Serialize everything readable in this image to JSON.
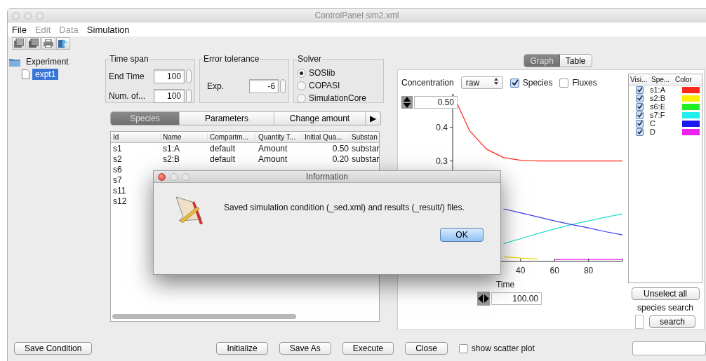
{
  "window": {
    "title": "ControlPanel sim2.xml"
  },
  "menu": [
    {
      "label": "File",
      "disabled": false
    },
    {
      "label": "Edit",
      "disabled": true
    },
    {
      "label": "Data",
      "disabled": true
    },
    {
      "label": "Simulation",
      "disabled": false
    }
  ],
  "tree": [
    {
      "label": "Experiment",
      "kind": "folder",
      "selected": false,
      "children": [
        {
          "label": "expt1",
          "kind": "file",
          "selected": true
        }
      ]
    }
  ],
  "time_span": {
    "title": "Time span",
    "fields": [
      {
        "label": "End Time",
        "value": "100"
      },
      {
        "label": "Num. of...",
        "value": "100"
      }
    ]
  },
  "error_tolerance": {
    "title": "Error tolerance",
    "label": "Exp.",
    "value": "-6"
  },
  "solver": {
    "title": "Solver",
    "options": [
      {
        "label": "SOSlib",
        "selected": true
      },
      {
        "label": "COPASI",
        "selected": false
      },
      {
        "label": "SimulationCore",
        "selected": false
      }
    ]
  },
  "species_tabs": [
    {
      "label": "Species",
      "selected": true
    },
    {
      "label": "Parameters",
      "selected": false
    },
    {
      "label": "Change amount",
      "selected": false
    }
  ],
  "species_tabs_more": "▶",
  "species_table": {
    "columns": [
      "Id",
      "Name",
      "Compartm...",
      "Quantity T...",
      "Initial Qua...",
      "Substan"
    ],
    "rows": [
      [
        "s1",
        "s1:A",
        "default",
        "Amount",
        "0.50",
        "substar"
      ],
      [
        "s2",
        "s2:B",
        "default",
        "Amount",
        "0.20",
        "substar"
      ],
      [
        "s6"
      ],
      [
        "s7"
      ],
      [
        "s11"
      ],
      [
        "s12"
      ]
    ]
  },
  "result_tabs": [
    {
      "label": "Graph",
      "selected": true
    },
    {
      "label": "Table",
      "selected": false
    }
  ],
  "graph": {
    "label": "Concentration",
    "mode": "raw",
    "options": [
      {
        "label": "Species",
        "checked": true
      },
      {
        "label": "Fluxes",
        "checked": false
      }
    ],
    "y_max": "0.50",
    "x_max": "100.00",
    "chart_data": {
      "type": "line",
      "xlabel": "Time",
      "x": [
        0,
        10,
        20,
        30,
        40,
        50,
        60,
        70,
        80,
        90,
        100
      ],
      "xlim": [
        0,
        100
      ],
      "ylim": [
        0,
        0.5
      ],
      "xticks": [
        40,
        60,
        80
      ],
      "yticks": [
        0.3,
        0.4
      ],
      "series": [
        {
          "color": "#ff2a1a",
          "values": [
            0.5,
            0.39,
            0.335,
            0.31,
            0.302,
            0.3,
            0.3,
            0.3,
            0.3,
            0.3,
            0.3
          ]
        },
        {
          "color": "#e8d800",
          "values": [
            null,
            null,
            null,
            0.014,
            0.01,
            0.007,
            null,
            null,
            null,
            null,
            null
          ]
        },
        {
          "color": "#22ddcc",
          "values": [
            null,
            null,
            null,
            0.053,
            0.068,
            0.083,
            0.097,
            0.11,
            0.121,
            0.132,
            0.142
          ]
        },
        {
          "color": "#3a3aee",
          "values": [
            null,
            null,
            null,
            0.157,
            0.145,
            0.133,
            0.121,
            0.11,
            0.1,
            0.089,
            0.079
          ]
        },
        {
          "color": "#ee22ee",
          "values": [
            null,
            null,
            null,
            null,
            null,
            null,
            0.006,
            0.006,
            0.006,
            0.006,
            0.006
          ]
        }
      ]
    }
  },
  "legend": {
    "columns": [
      "Visi...",
      "Spe...",
      "Color"
    ],
    "rows": [
      {
        "species": "s1:A",
        "visible": true,
        "color": "#ff2a1a"
      },
      {
        "species": "s2:B",
        "visible": true,
        "color": "#ffee00"
      },
      {
        "species": "s6:E",
        "visible": true,
        "color": "#22ee22"
      },
      {
        "species": "s7:F",
        "visible": true,
        "color": "#22eeee"
      },
      {
        "species": "C",
        "visible": true,
        "color": "#1a1aee"
      },
      {
        "species": "D",
        "visible": true,
        "color": "#ee22ee"
      }
    ]
  },
  "unselect_button": "Unselect all",
  "species_search": {
    "label": "species search",
    "button": "search"
  },
  "bottom_buttons": [
    "Save Condition",
    "Initialize",
    "Save As",
    "Execute",
    "Close"
  ],
  "scatter": {
    "label": "show scatter plot",
    "checked": false
  },
  "dialog": {
    "title": "Information",
    "message": "Saved simulation condition (_sed.xml) and results (_result/) files.",
    "button": "OK"
  }
}
